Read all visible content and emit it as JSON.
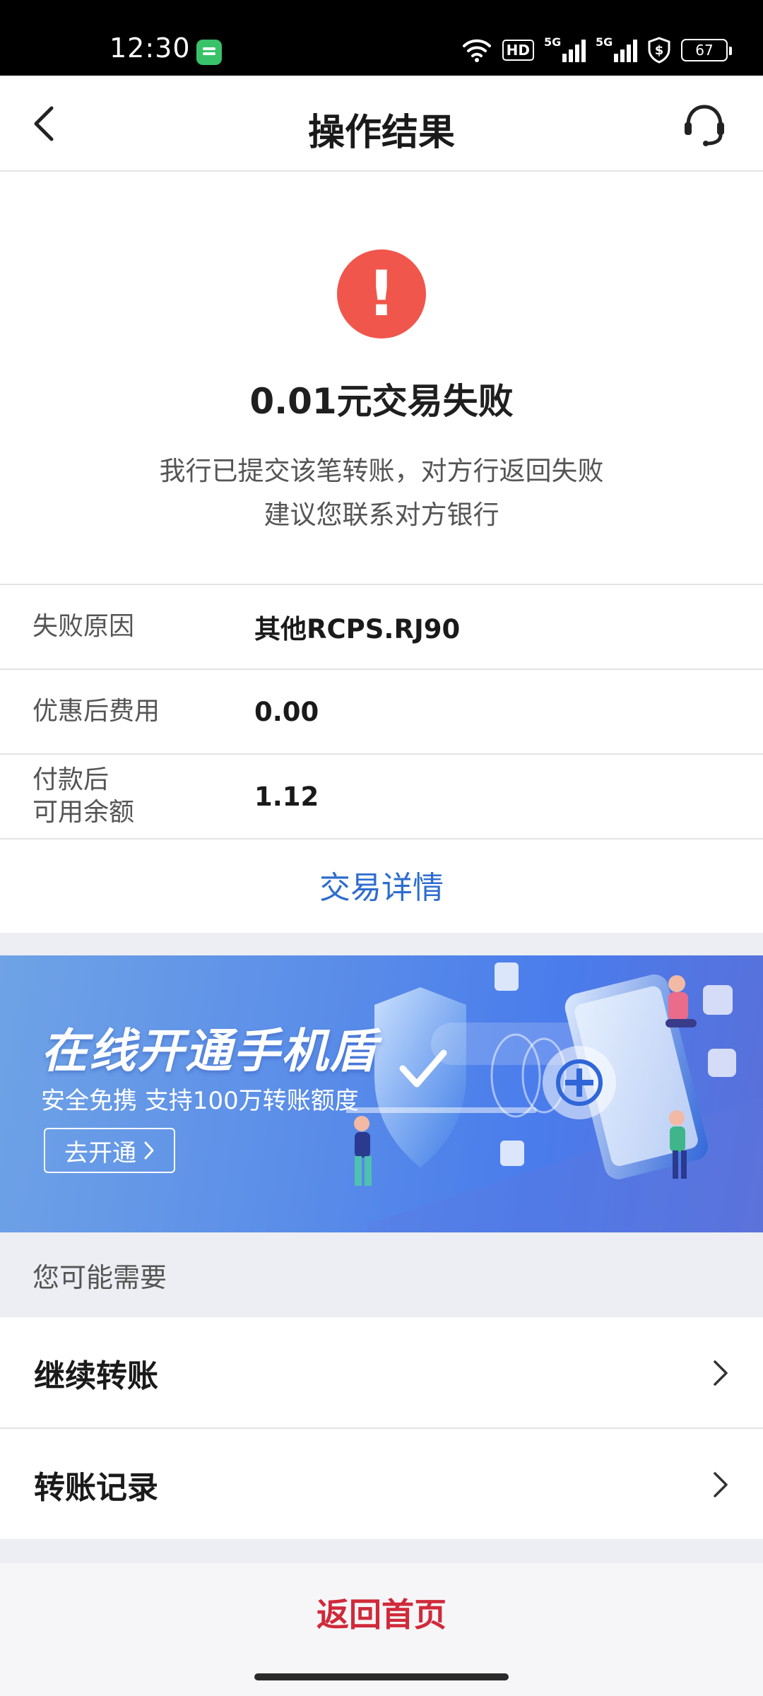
{
  "status_bar": {
    "time": "12:30",
    "hd_badge": "HD",
    "sim1": "5G",
    "sim2": "5G",
    "battery": "67"
  },
  "nav": {
    "title": "操作结果"
  },
  "result": {
    "title": "0.01元交易失败",
    "desc_line1": "我行已提交该笔转账，对方行返回失败",
    "desc_line2": "建议您联系对方银行"
  },
  "info_rows": [
    {
      "label": "失败原因",
      "value": "其他RCPS.RJ90"
    },
    {
      "label": "优惠后费用",
      "value": "0.00"
    },
    {
      "label_line1": "付款后",
      "label_line2": "可用余额",
      "value": "1.12"
    }
  ],
  "detail_link": "交易详情",
  "banner": {
    "title": "在线开通手机盾",
    "subtitle": "安全免携 支持100万转账额度",
    "button": "去开通"
  },
  "need": {
    "heading": "您可能需要",
    "items": [
      {
        "label": "继续转账"
      },
      {
        "label": "转账记录"
      }
    ]
  },
  "home_button": "返回首页",
  "colors": {
    "error_red": "#f0564b",
    "link_blue": "#2e6ccf",
    "home_red": "#d02a3a"
  }
}
